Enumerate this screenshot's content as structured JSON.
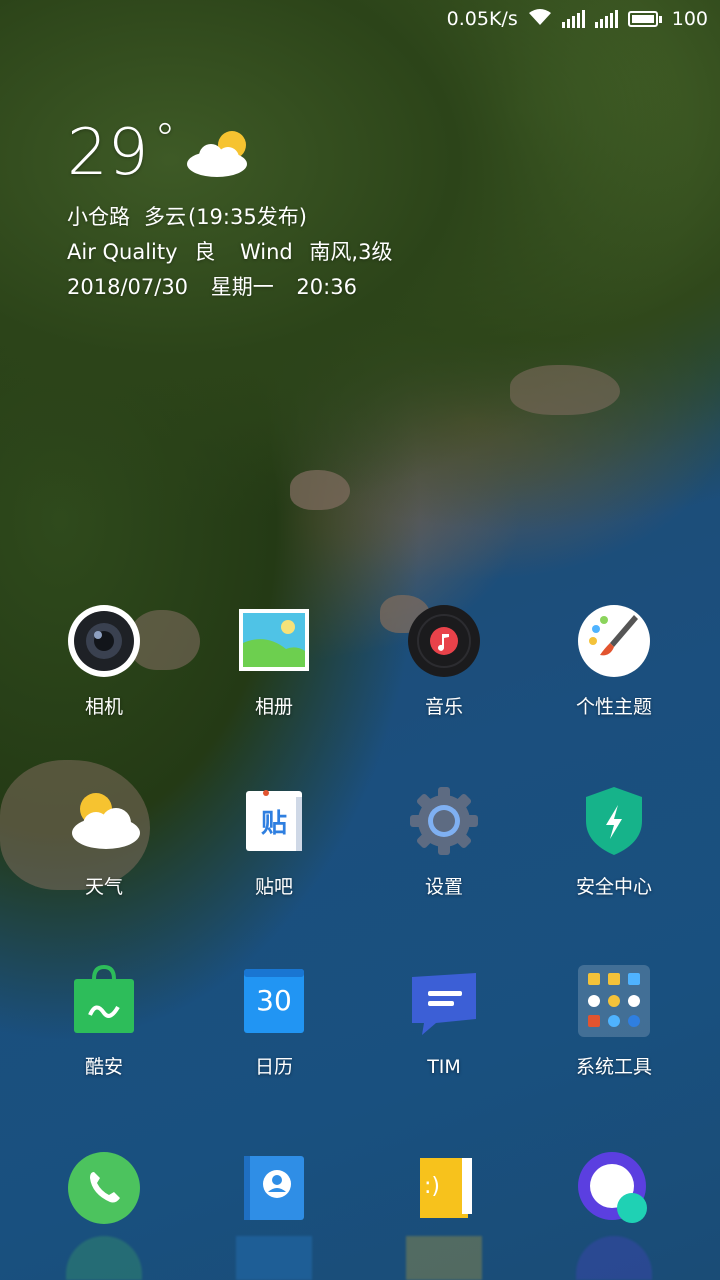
{
  "status_bar": {
    "net_speed": "0.05K/s",
    "battery": "100",
    "icons": [
      "wifi-icon",
      "signal-icon",
      "signal-icon",
      "battery-icon"
    ]
  },
  "weather_widget": {
    "temperature": "29",
    "degree": "°",
    "location": "小仓路",
    "condition": "多云",
    "published": "(19:35发布)",
    "air_quality_label": "Air Quality",
    "air_quality_value": "良",
    "wind_label": "Wind",
    "wind_value": "南风,3级",
    "date": "2018/07/30",
    "weekday": "星期一",
    "time": "20:36",
    "icon": "partly-cloudy-icon"
  },
  "apps": [
    {
      "label": "相机",
      "icon": "camera-icon"
    },
    {
      "label": "相册",
      "icon": "gallery-icon"
    },
    {
      "label": "音乐",
      "icon": "music-icon"
    },
    {
      "label": "个性主题",
      "icon": "theme-brush-icon"
    },
    {
      "label": "天气",
      "icon": "weather-icon"
    },
    {
      "label": "贴吧",
      "icon": "tieba-icon",
      "glyph": "贴"
    },
    {
      "label": "设置",
      "icon": "settings-gear-icon"
    },
    {
      "label": "安全中心",
      "icon": "security-shield-icon"
    },
    {
      "label": "酷安",
      "icon": "coolapk-icon"
    },
    {
      "label": "日历",
      "icon": "calendar-icon",
      "glyph": "30"
    },
    {
      "label": "TIM",
      "icon": "tim-icon"
    },
    {
      "label": "系统工具",
      "icon": "system-tools-folder-icon"
    }
  ],
  "dock": [
    {
      "icon": "phone-icon"
    },
    {
      "icon": "contacts-icon"
    },
    {
      "icon": "messages-icon",
      "glyph": ":)"
    },
    {
      "icon": "browser-icon"
    }
  ],
  "colors": {
    "phone_green": "#4cc35e",
    "contacts_blue": "#2f8ee6",
    "messages_yellow": "#f7c21c",
    "browser_purple": "#5b3fe0",
    "security_green": "#16b38a",
    "coolapk_green": "#2dbd5a",
    "calendar_blue": "#2195f3",
    "tim_blue": "#3c5fd6"
  }
}
